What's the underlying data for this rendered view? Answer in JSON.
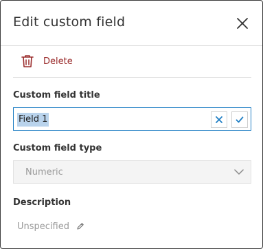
{
  "dialog": {
    "title": "Edit custom field",
    "close_icon": "close-icon"
  },
  "actions": {
    "delete_label": "Delete",
    "delete_icon": "trash-icon",
    "delete_color": "#9a2b2b"
  },
  "fields": {
    "title": {
      "label": "Custom field title",
      "value": "Field 1",
      "clear_icon": "x-icon",
      "confirm_icon": "check-icon",
      "accent_color": "#1f7ec4"
    },
    "type": {
      "label": "Custom field type",
      "selected": "Numeric",
      "disabled": true,
      "chevron_icon": "chevron-down-icon"
    },
    "description": {
      "label": "Description",
      "value": "Unspecified",
      "edit_icon": "pencil-icon"
    }
  }
}
